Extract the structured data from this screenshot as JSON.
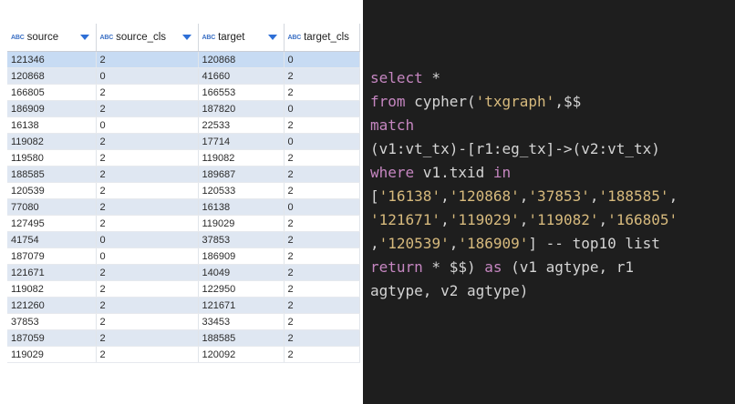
{
  "grid": {
    "columns": [
      {
        "type_badge": "ABC",
        "label": "source"
      },
      {
        "type_badge": "ABC",
        "label": "source_cls"
      },
      {
        "type_badge": "ABC",
        "label": "target"
      },
      {
        "type_badge": "ABC",
        "label": "target_cls"
      }
    ],
    "rows": [
      [
        "121346",
        "2",
        "120868",
        "0"
      ],
      [
        "120868",
        "0",
        "41660",
        "2"
      ],
      [
        "166805",
        "2",
        "166553",
        "2"
      ],
      [
        "186909",
        "2",
        "187820",
        "0"
      ],
      [
        "16138",
        "0",
        "22533",
        "2"
      ],
      [
        "119082",
        "2",
        "17714",
        "0"
      ],
      [
        "119580",
        "2",
        "119082",
        "2"
      ],
      [
        "188585",
        "2",
        "189687",
        "2"
      ],
      [
        "120539",
        "2",
        "120533",
        "2"
      ],
      [
        "77080",
        "2",
        "16138",
        "0"
      ],
      [
        "127495",
        "2",
        "119029",
        "2"
      ],
      [
        "41754",
        "0",
        "37853",
        "2"
      ],
      [
        "187079",
        "0",
        "186909",
        "2"
      ],
      [
        "121671",
        "2",
        "14049",
        "2"
      ],
      [
        "119082",
        "2",
        "122950",
        "2"
      ],
      [
        "121260",
        "2",
        "121671",
        "2"
      ],
      [
        "37853",
        "2",
        "33453",
        "2"
      ],
      [
        "187059",
        "2",
        "188585",
        "2"
      ],
      [
        "119029",
        "2",
        "120092",
        "2"
      ]
    ],
    "selected_row": 0,
    "colors": {
      "selected": "#c7dbf3",
      "stripe": "#dfe7f2",
      "accent": "#2e6fd6"
    }
  },
  "editor": {
    "lines": [
      [
        {
          "t": "select",
          "c": "kw"
        },
        {
          "t": " *",
          "c": ""
        }
      ],
      [
        {
          "t": "from ",
          "c": "kw"
        },
        {
          "t": "cypher(",
          "c": ""
        },
        {
          "t": "'txgraph'",
          "c": "str"
        },
        {
          "t": ",$$",
          "c": ""
        }
      ],
      [
        {
          "t": "match",
          "c": "kw"
        }
      ],
      [
        {
          "t": "(v1:vt_tx)-[r1:eg_tx]->(v2:vt_tx)",
          "c": ""
        }
      ],
      [
        {
          "t": "where",
          "c": "kw"
        },
        {
          "t": " v1.txid ",
          "c": ""
        },
        {
          "t": "in",
          "c": "kw"
        }
      ],
      [
        {
          "t": "[",
          "c": ""
        },
        {
          "t": "'16138'",
          "c": "str"
        },
        {
          "t": ",",
          "c": ""
        },
        {
          "t": "'120868'",
          "c": "str"
        },
        {
          "t": ",",
          "c": ""
        },
        {
          "t": "'37853'",
          "c": "str"
        },
        {
          "t": ",",
          "c": ""
        },
        {
          "t": "'188585'",
          "c": "str"
        },
        {
          "t": ",",
          "c": ""
        }
      ],
      [
        {
          "t": "'121671'",
          "c": "str"
        },
        {
          "t": ",",
          "c": ""
        },
        {
          "t": "'119029'",
          "c": "str"
        },
        {
          "t": ",",
          "c": ""
        },
        {
          "t": "'119082'",
          "c": "str"
        },
        {
          "t": ",",
          "c": ""
        },
        {
          "t": "'166805'",
          "c": "str"
        }
      ],
      [
        {
          "t": ",",
          "c": ""
        },
        {
          "t": "'120539'",
          "c": "str"
        },
        {
          "t": ",",
          "c": ""
        },
        {
          "t": "'186909'",
          "c": "str"
        },
        {
          "t": "] -- top10 list",
          "c": "cmt"
        }
      ],
      [
        {
          "t": "return",
          "c": "kw"
        },
        {
          "t": " * $$) ",
          "c": ""
        },
        {
          "t": "as",
          "c": "kw"
        },
        {
          "t": " (v1 agtype, r1",
          "c": ""
        }
      ],
      [
        {
          "t": "agtype, v2 agtype)",
          "c": ""
        }
      ]
    ],
    "colors": {
      "background": "#1e1e1e",
      "keyword": "#c586c0",
      "string": "#d7ba7d",
      "text": "#d4d4d4"
    }
  }
}
